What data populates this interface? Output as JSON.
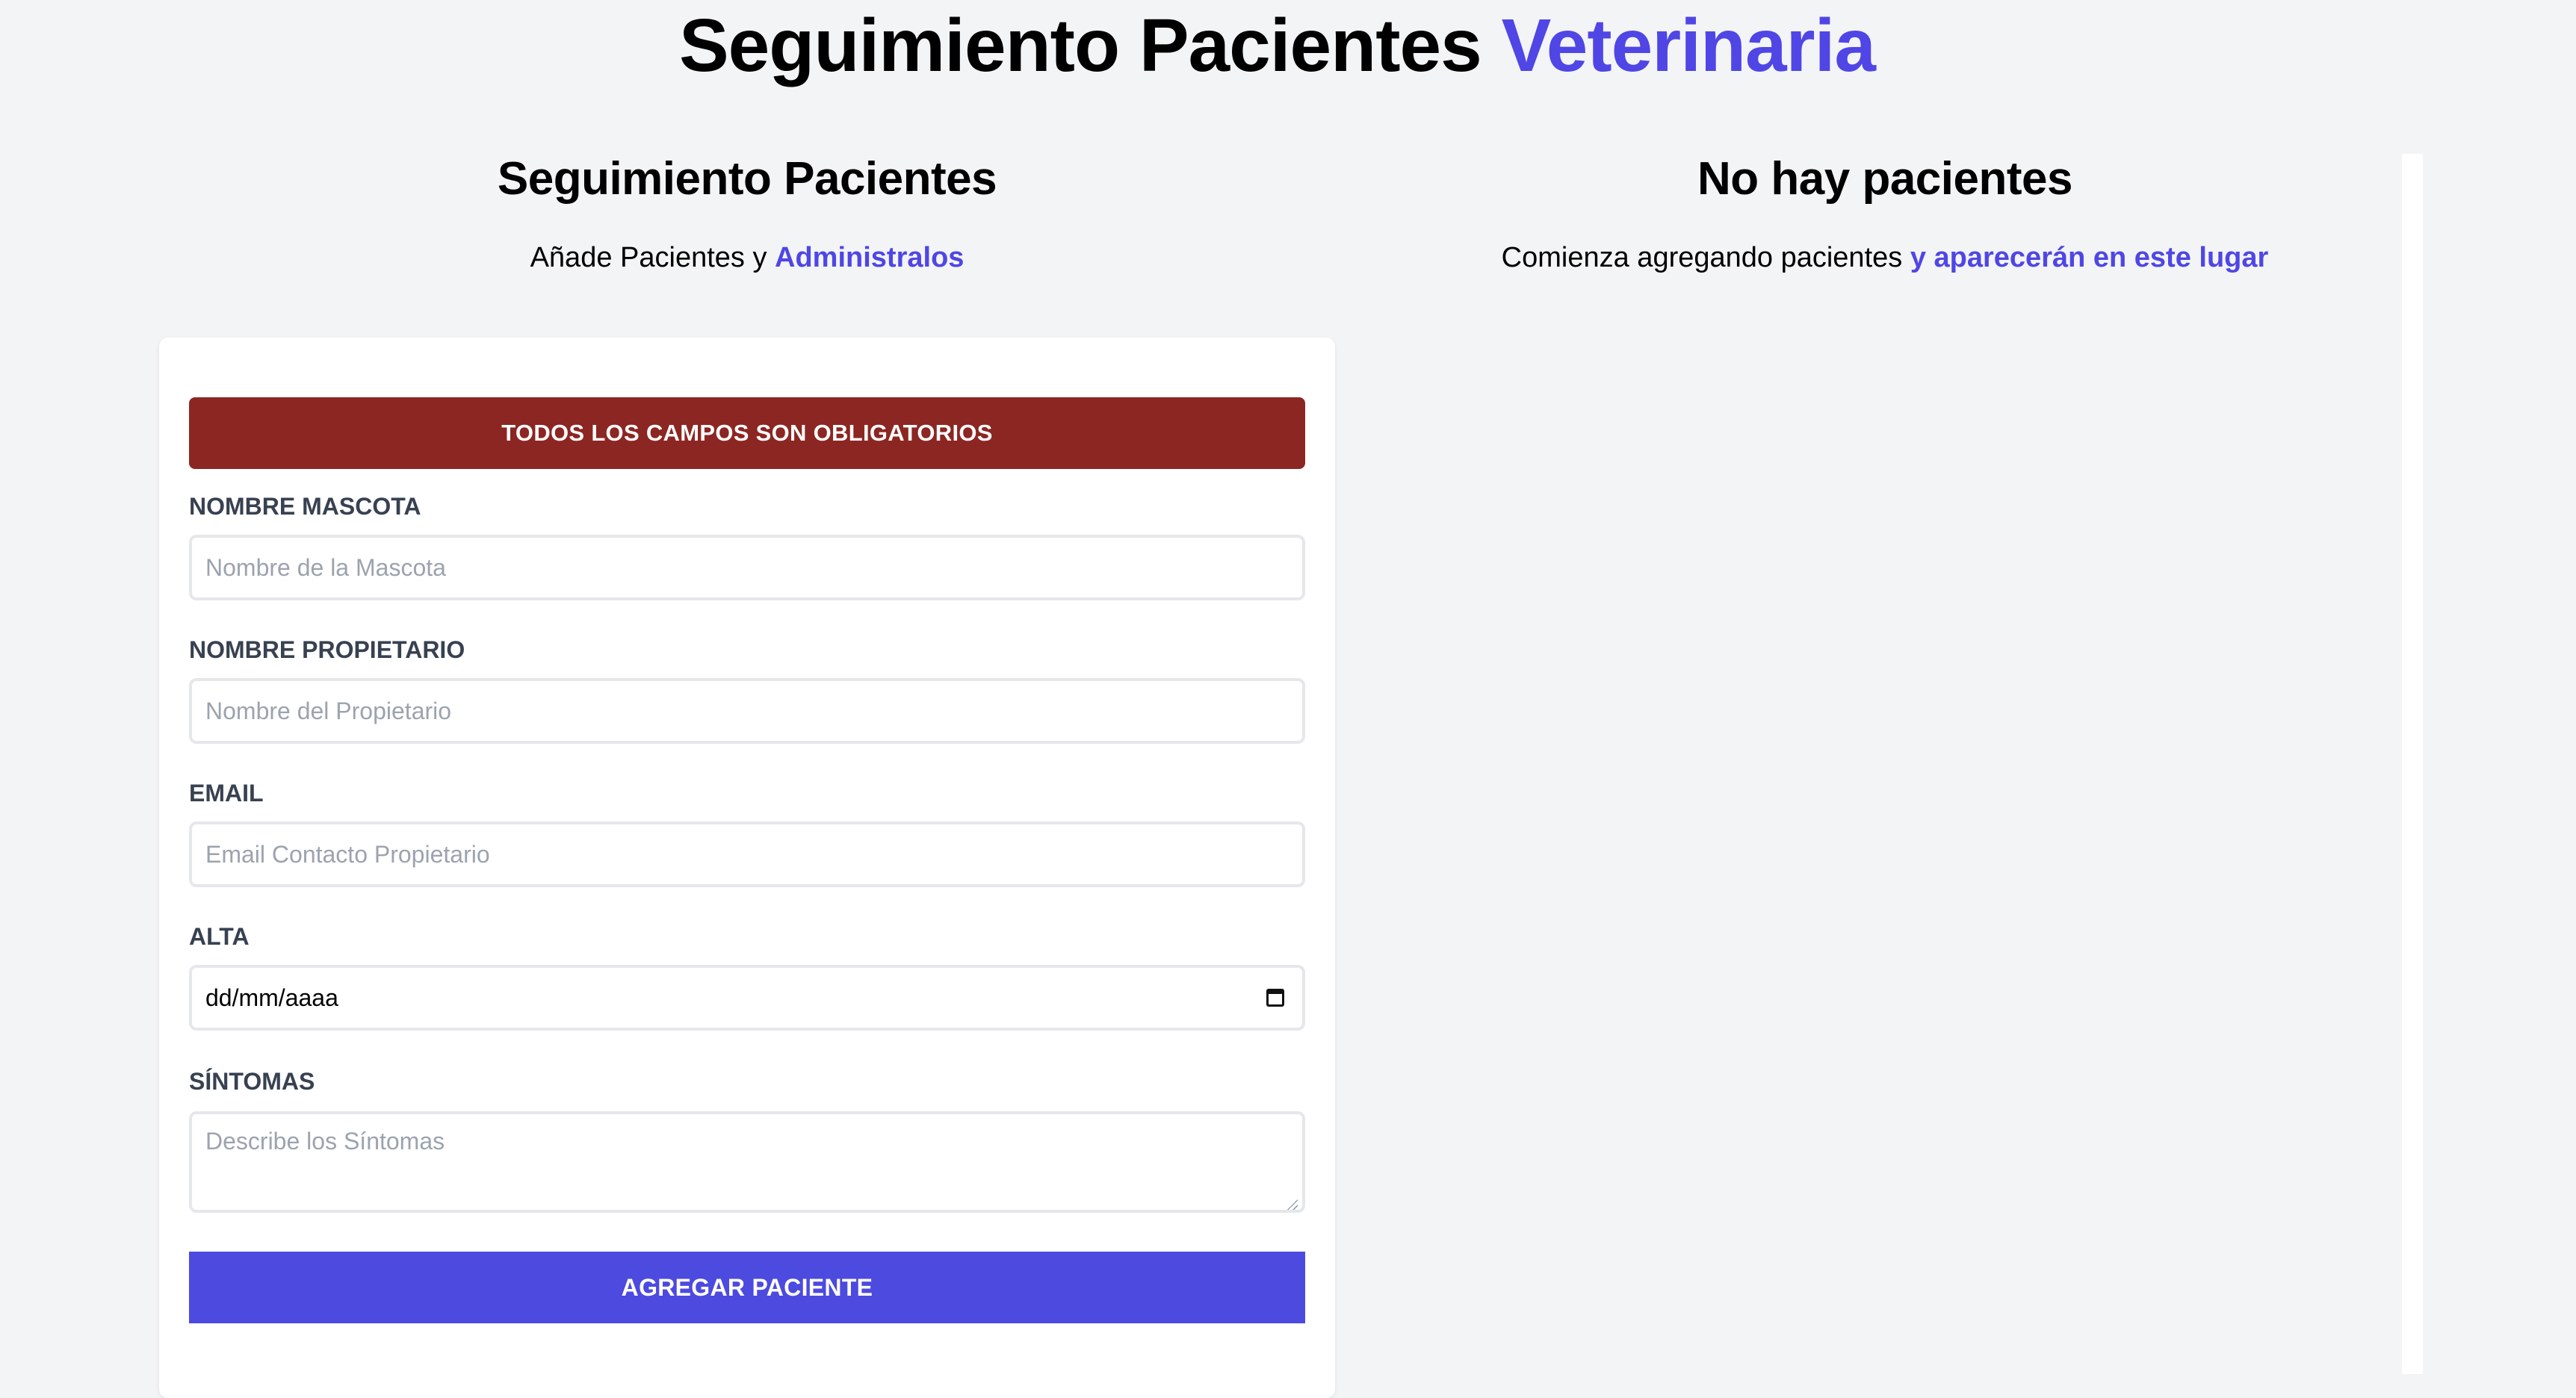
{
  "header": {
    "title_main": "Seguimiento Pacientes",
    "title_accent": "Veterinaria"
  },
  "form_panel": {
    "heading": "Seguimiento Pacientes",
    "subtitle_text": "Añade Pacientes y",
    "subtitle_accent": "Administralos"
  },
  "patients_panel": {
    "heading": "No hay pacientes",
    "subtitle_text": "Comienza agregando pacientes",
    "subtitle_accent": "y aparecerán en este lugar"
  },
  "form": {
    "error_message": "Todos los campos son obligatorios",
    "fields": {
      "pet_name": {
        "label": "Nombre Mascota",
        "placeholder": "Nombre de la Mascota",
        "value": ""
      },
      "owner_name": {
        "label": "Nombre Propietario",
        "placeholder": "Nombre del Propietario",
        "value": ""
      },
      "email": {
        "label": "Email",
        "placeholder": "Email Contacto Propietario",
        "value": ""
      },
      "discharge_date": {
        "label": "Alta",
        "value": "dd/mm/aaaa"
      },
      "symptoms": {
        "label": "Síntomas",
        "placeholder": "Describe los Síntomas",
        "value": ""
      }
    },
    "submit_label": "Agregar Paciente"
  },
  "icons": {
    "date_picker": "calendar-icon",
    "textarea_resize": "resize-grip-icon"
  },
  "colors": {
    "accent": "#4f46e5",
    "error": "#8c2622",
    "submit": "#4c4adf",
    "background": "#f3f4f6"
  }
}
